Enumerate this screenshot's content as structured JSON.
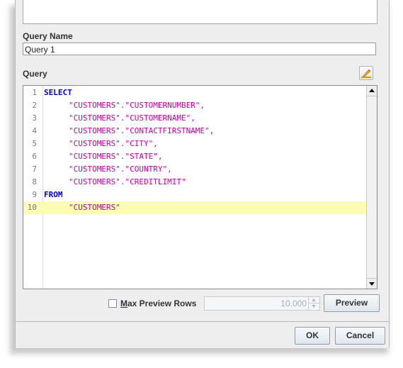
{
  "query_name": {
    "label": "Query Name",
    "value": "Query 1"
  },
  "query": {
    "label": "Query",
    "edit_icon": "pencil-icon",
    "current_line": 10,
    "lines": [
      {
        "num": "1",
        "keyword": "SELECT",
        "text": ""
      },
      {
        "num": "2",
        "keyword": "",
        "text": "\"CUSTOMERS\".\"CUSTOMERNUMBER\","
      },
      {
        "num": "3",
        "keyword": "",
        "text": "\"CUSTOMERS\".\"CUSTOMERNAME\","
      },
      {
        "num": "4",
        "keyword": "",
        "text": "\"CUSTOMERS\".\"CONTACTFIRSTNAME\","
      },
      {
        "num": "5",
        "keyword": "",
        "text": "\"CUSTOMERS\".\"CITY\","
      },
      {
        "num": "6",
        "keyword": "",
        "text": "\"CUSTOMERS\".\"STATE\","
      },
      {
        "num": "7",
        "keyword": "",
        "text": "\"CUSTOMERS\".\"COUNTRY\","
      },
      {
        "num": "8",
        "keyword": "",
        "text": "\"CUSTOMERS\".\"CREDITLIMIT\""
      },
      {
        "num": "9",
        "keyword": "FROM",
        "text": ""
      },
      {
        "num": "10",
        "keyword": "",
        "text": "\"CUSTOMERS\""
      }
    ]
  },
  "preview": {
    "max_rows_label_mnemonic": "M",
    "max_rows_label_rest": "ax Preview Rows",
    "max_rows_checked": false,
    "max_rows_value": "10.000",
    "preview_button": "Preview"
  },
  "footer": {
    "ok_button": "OK",
    "cancel_button": "Cancel"
  },
  "colors": {
    "keyword": "#0000d0",
    "string": "#c800a8",
    "current_line_highlight": "#fdfbb4"
  }
}
